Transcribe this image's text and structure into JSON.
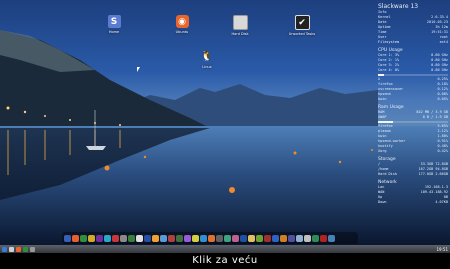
{
  "desktop_icons": [
    {
      "name": "home",
      "label": "Home",
      "glyph": "S",
      "color": "#5a7bd0"
    },
    {
      "name": "ubuntu",
      "label": "Ubuntu",
      "glyph": "◉",
      "color": "#e8662d"
    },
    {
      "name": "harddisk",
      "label": "Hard Disk",
      "glyph": "",
      "color": "#d8d8d8"
    },
    {
      "name": "tasks",
      "label": "Unsorted Tasks",
      "glyph": "✔",
      "color": "#222222"
    },
    {
      "name": "linux",
      "label": "Linux",
      "glyph": "🐧",
      "color": "transparent"
    }
  ],
  "conky": {
    "title": "Slackware 13",
    "subtitle": "Info",
    "info_rows": [
      {
        "k": "Kernel",
        "v": "2.6.33.4"
      },
      {
        "k": "Date",
        "v": "2010-05-23"
      },
      {
        "k": "Uptime",
        "v": "3h 12m"
      },
      {
        "k": "Time",
        "v": "19:51:31"
      },
      {
        "k": "User",
        "v": "root"
      },
      {
        "k": "Filesystem",
        "v": "ext4"
      }
    ],
    "cpu_title": "CPU Usage",
    "cpu_rows": [
      {
        "k": "Core 1: 3%",
        "v": "0.80 GHz"
      },
      {
        "k": "Core 2: 1%",
        "v": "0.80 GHz"
      },
      {
        "k": "Core 3: 2%",
        "v": "0.80 GHz"
      },
      {
        "k": "Core 4: 0%",
        "v": "0.80 GHz"
      }
    ],
    "proc_rows": [
      {
        "k": "X",
        "v": "0.25%"
      },
      {
        "k": "firefox",
        "v": "0.18%"
      },
      {
        "k": "xscreensaver",
        "v": "0.12%"
      },
      {
        "k": "hpsend",
        "v": "0.08%"
      },
      {
        "k": "kwin",
        "v": "0.05%"
      }
    ],
    "ram_title": "Ram Usage",
    "ram_rows": [
      {
        "k": "RAM",
        "v": "842 MB / 3.9 GB"
      },
      {
        "k": "SWAP",
        "v": "0 B / 1.9 GB"
      }
    ],
    "mem_rows": [
      {
        "k": "firefox",
        "v": "5.65%"
      },
      {
        "k": "plasma",
        "v": "2.12%"
      },
      {
        "k": "kwin",
        "v": "1.80%"
      },
      {
        "k": "hpsend-worker",
        "v": "0.91%"
      },
      {
        "k": "knotify",
        "v": "0.48%"
      },
      {
        "k": "Xorg",
        "v": "0.42%"
      }
    ],
    "storage_title": "Storage",
    "storage_rows": [
      {
        "k": "/",
        "v": "53.3GB  72.8GB"
      },
      {
        "k": "/home",
        "v": "167.2GB  94.8GB"
      },
      {
        "k": "Hard Disk",
        "v": "177.0GB  2.66GB"
      }
    ],
    "net_title": "Network",
    "net_rows": [
      {
        "k": "Lan",
        "v": "192.168.1.3"
      },
      {
        "k": "WAN",
        "v": "109.43.188.92"
      },
      {
        "k": "Up",
        "v": "0B"
      },
      {
        "k": "Down",
        "v": "4.07KB"
      }
    ]
  },
  "dock_icon_count": 34,
  "dock_colors": [
    "#3a5fb0",
    "#e85e2c",
    "#2f8f3f",
    "#d6a72a",
    "#6d2f9e",
    "#2aa6c8",
    "#c73737",
    "#8a8a8a",
    "#3b7d3b",
    "#e0e0e0",
    "#2b4fa0",
    "#f0a030",
    "#5a9ad6",
    "#b04040",
    "#407040",
    "#9a5ad6",
    "#d0d040",
    "#3090d0",
    "#e07030",
    "#606060",
    "#40a080",
    "#c06090",
    "#2050a0",
    "#e0c060",
    "#70a030",
    "#a03030",
    "#3060c0",
    "#d08020",
    "#5050a0",
    "#90b0d0",
    "#c0c0c0",
    "#2e8b57",
    "#b22222",
    "#4682b4"
  ],
  "taskbar": {
    "clock": "19:51"
  },
  "caption": "Klik za veću"
}
